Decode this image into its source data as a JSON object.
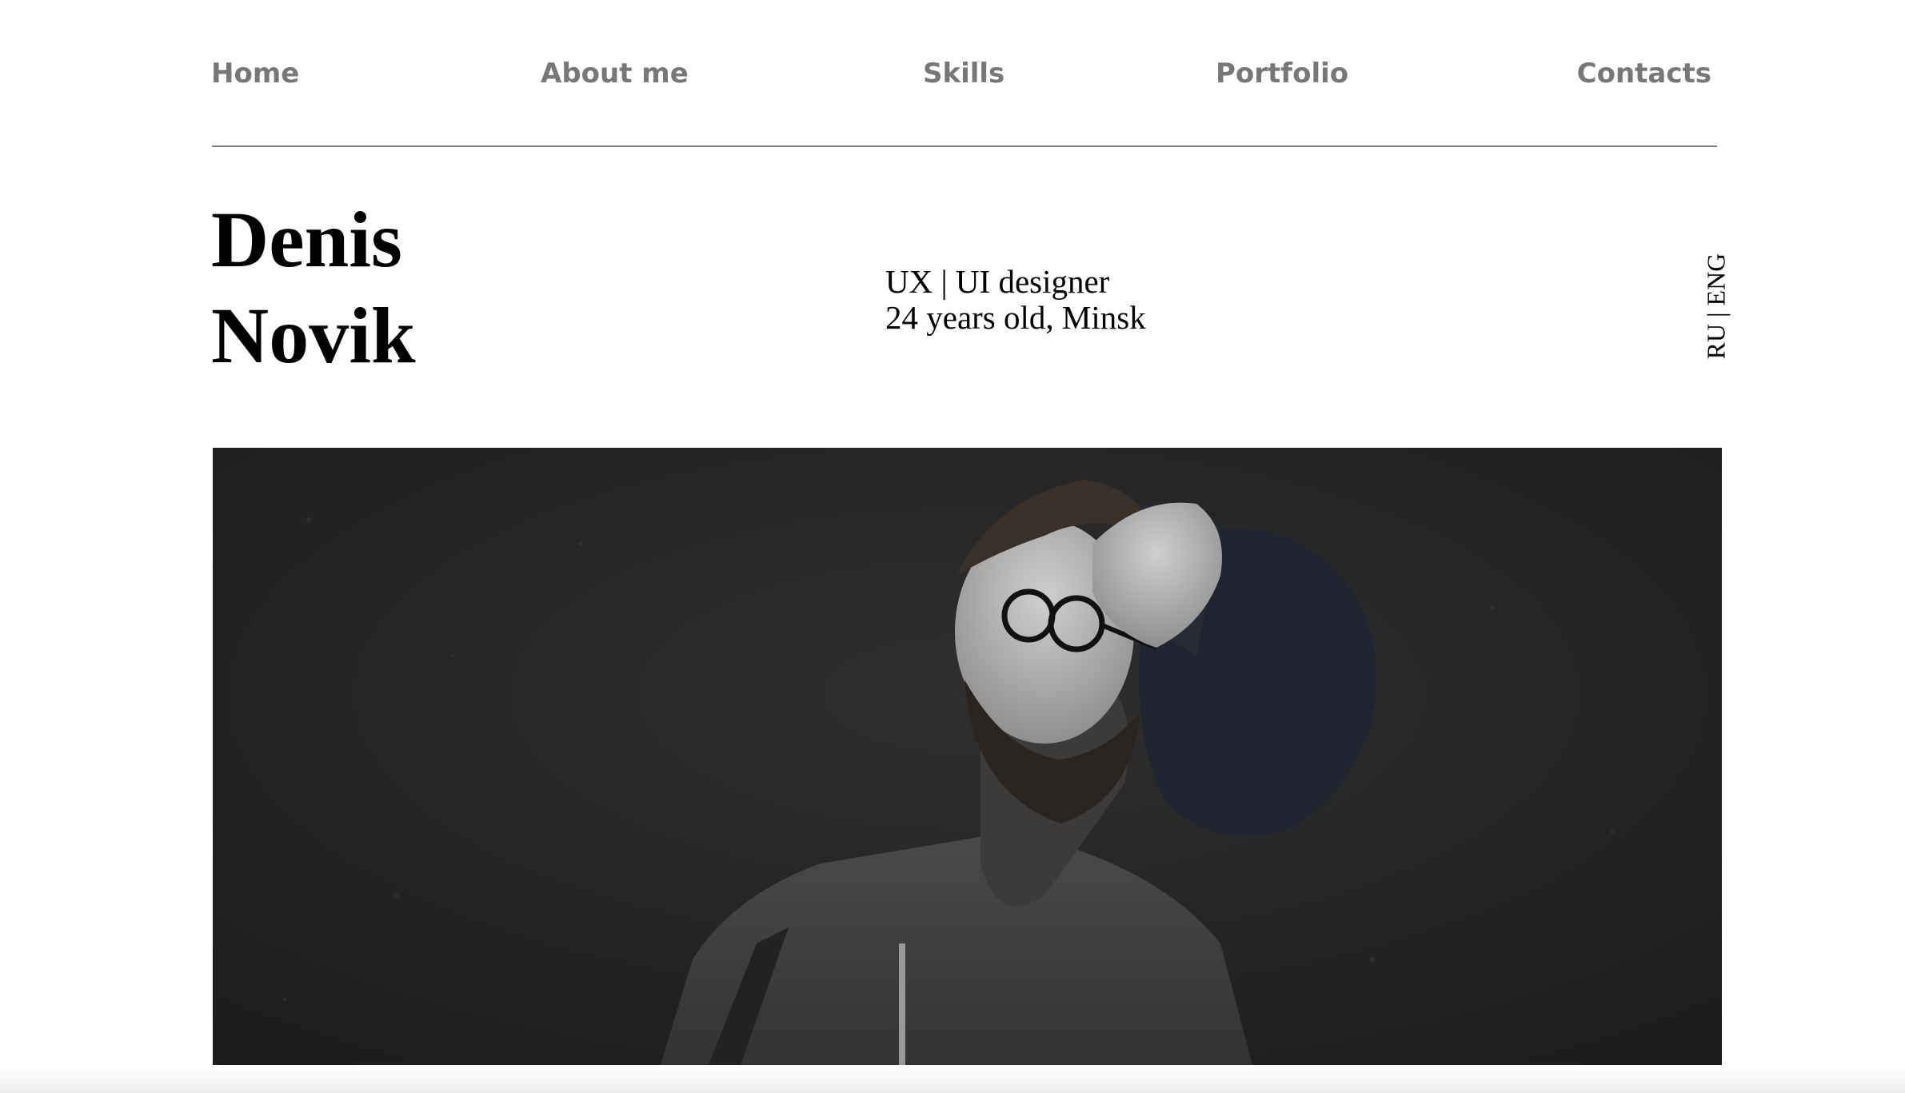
{
  "nav": {
    "items": [
      "Home",
      "About me",
      "Skills",
      "Portfolio",
      "Contacts"
    ]
  },
  "hero": {
    "first_name": "Denis",
    "last_name": "Novik",
    "role": "UX | UI designer",
    "details": "24 years old, Minsk"
  },
  "language_switch": {
    "label": "RU | ENG"
  },
  "colors": {
    "nav_text": "#777777",
    "divider": "#7a7a7a",
    "heading": "#000000",
    "photo_background": "#2a2a2a"
  },
  "icons": [
    "portrait-photo"
  ]
}
